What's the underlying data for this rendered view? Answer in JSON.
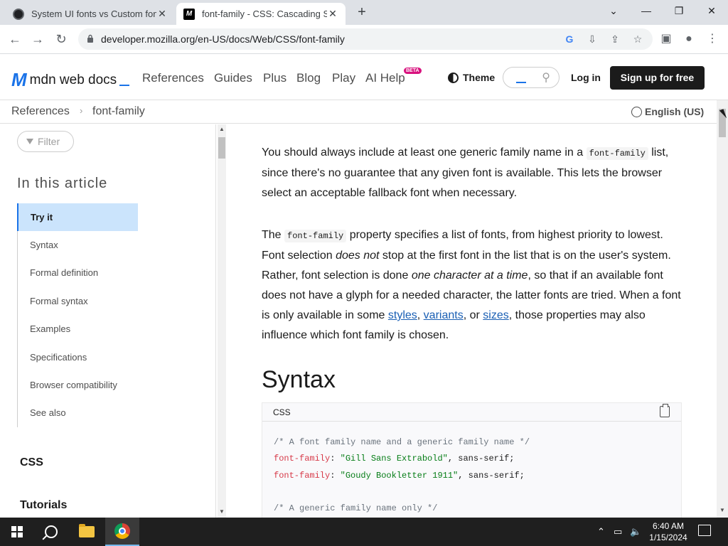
{
  "browser": {
    "tabs": [
      {
        "title": "System UI fonts vs Custom fonts",
        "active": false
      },
      {
        "title": "font-family - CSS: Cascading Style Sheets | MDN",
        "active": true
      }
    ],
    "new_tab": "+",
    "url": "developer.mozilla.org/en-US/docs/Web/CSS/font-family"
  },
  "mdn": {
    "logo_text": "mdn web docs",
    "nav": [
      "References",
      "Guides",
      "Plus",
      "Blog",
      "Play",
      "AI Help"
    ],
    "beta": "BETA",
    "theme": "Theme",
    "login": "Log in",
    "signup": "Sign up for free"
  },
  "breadcrumb": {
    "root": "References",
    "current": "font-family",
    "language": "English (US)"
  },
  "sidebar": {
    "filter_placeholder": "Filter",
    "toc_heading": "In this article",
    "toc": [
      {
        "label": "Try it",
        "active": true
      },
      {
        "label": "Syntax"
      },
      {
        "label": "Formal definition"
      },
      {
        "label": "Formal syntax"
      },
      {
        "label": "Examples"
      },
      {
        "label": "Specifications"
      },
      {
        "label": "Browser compatibility"
      },
      {
        "label": "See also"
      }
    ],
    "section_css": "CSS",
    "section_tutorials": "Tutorials"
  },
  "content": {
    "p1_a": "You should always include at least one generic family name in a",
    "p1_code": "font-family",
    "p1_b": "list, since there's no guarantee that any given font is available. This lets the browser select an acceptable fallback font when necessary.",
    "p2_a": "The",
    "p2_code": "font-family",
    "p2_b": "property specifies a list of fonts, from highest priority to lowest. Font selection",
    "p2_em1": "does not",
    "p2_c": "stop at the first font in the list that is on the user's system. Rather, font selection is done",
    "p2_em2": "one character at a time",
    "p2_d": ", so that if an available font does not have a glyph for a needed character, the latter fonts are tried. When a font is only available in some",
    "p2_link1": "styles",
    "p2_link2": "variants",
    "p2_or": ", or",
    "p2_link3": "sizes",
    "p2_e": ", those properties may also influence which font family is chosen.",
    "syntax_heading": "Syntax",
    "code_lang": "CSS",
    "code_lines": {
      "c1": "/* A font family name and a generic family name */",
      "l1_prop": "font-family",
      "l1_val": "\"Gill Sans Extrabold\"",
      "l1_rest": ", sans-serif;",
      "l2_prop": "font-family",
      "l2_val": "\"Goudy Bookletter 1911\"",
      "l2_rest": ", sans-serif;",
      "c2": "/* A generic family name only */"
    }
  },
  "taskbar": {
    "time": "6:40 AM",
    "date": "1/15/2024"
  }
}
